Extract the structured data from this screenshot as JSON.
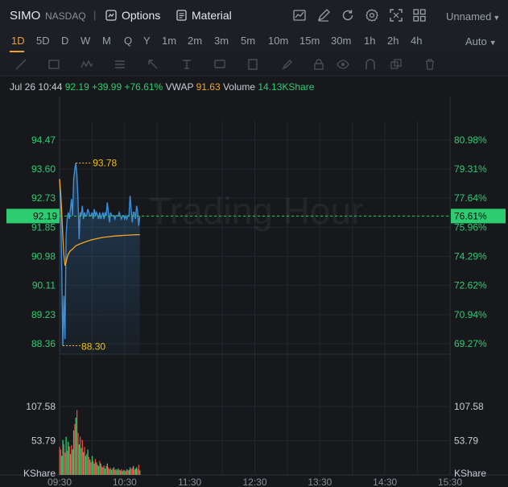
{
  "header": {
    "symbol": "SIMO",
    "exchange": "NASDAQ",
    "options_label": "Options",
    "material_label": "Material",
    "layout_name": "Unnamed",
    "icons": [
      "options-icon",
      "material-icon",
      "chart-type-icon",
      "draw-icon",
      "refresh-icon",
      "settings-icon",
      "fullscreen-icon",
      "layout-icon"
    ]
  },
  "periods": {
    "items": [
      "1D",
      "5D",
      "D",
      "W",
      "M",
      "Q",
      "Y",
      "1m",
      "2m",
      "3m",
      "5m",
      "10m",
      "15m",
      "30m",
      "1h",
      "2h",
      "4h"
    ],
    "active": "1D",
    "mode": "Auto"
  },
  "drawing_tools": [
    "line-tool-icon",
    "rectangle-tool-icon",
    "wave-tool-icon",
    "fib-tool-icon",
    "arrow-tool-icon",
    "text-tool-icon",
    "label-tool-icon",
    "ruler-tool-icon",
    "pen-tool-icon",
    "lock-icon",
    "eye-icon",
    "magnet-icon",
    "copy-icon",
    "trash-icon"
  ],
  "quote": {
    "datetime": "Jul 26 10:44",
    "price": "92.19",
    "change": "+39.99",
    "change_pct": "+76.61%",
    "vwap_label": "VWAP",
    "vwap_value": "91.63",
    "volume_label": "Volume",
    "volume_value": "14.13KShare"
  },
  "chart_data": {
    "type": "line",
    "watermark": "Trading Hour",
    "price_ticks_left": [
      "94.47",
      "93.60",
      "92.73",
      "91.85",
      "90.98",
      "90.11",
      "89.23",
      "88.36"
    ],
    "pct_ticks_right": [
      "80.98%",
      "79.31%",
      "77.64%",
      "75.96%",
      "74.29%",
      "72.62%",
      "70.94%",
      "69.27%"
    ],
    "current_price_tag": "92.19",
    "current_pct_tag": "76.61%",
    "high_label": "93.78",
    "low_label": "88.30",
    "time_labels": [
      "09:30",
      "10:30",
      "11:30",
      "12:30",
      "13:30",
      "14:30",
      "15:30"
    ],
    "volume_ticks": [
      "107.58",
      "53.79"
    ],
    "volume_unit": "KShare",
    "colors": {
      "price": "#3d8fd9",
      "vwap": "#f5a623",
      "up": "#2ecc71",
      "down": "#e74c3c",
      "tag": "#2ecc71",
      "annot": "#f5c000"
    },
    "price_series": [
      [
        "09:30",
        93.3
      ],
      [
        "09:31",
        92.6
      ],
      [
        "09:32",
        90.6
      ],
      [
        "09:33",
        88.3
      ],
      [
        "09:34",
        89.8
      ],
      [
        "09:35",
        88.5
      ],
      [
        "09:36",
        91.6
      ],
      [
        "09:37",
        92.1
      ],
      [
        "09:38",
        92.3
      ],
      [
        "09:39",
        92.1
      ],
      [
        "09:40",
        92.4
      ],
      [
        "09:41",
        92.7
      ],
      [
        "09:42",
        92.2
      ],
      [
        "09:43",
        93.3
      ],
      [
        "09:44",
        93.6
      ],
      [
        "09:45",
        93.78
      ],
      [
        "09:46",
        93.4
      ],
      [
        "09:47",
        92.7
      ],
      [
        "09:48",
        91.5
      ],
      [
        "09:49",
        92.3
      ],
      [
        "09:50",
        92.2
      ],
      [
        "09:51",
        92.5
      ],
      [
        "09:52",
        92.1
      ],
      [
        "09:53",
        92.3
      ],
      [
        "09:54",
        92.2
      ],
      [
        "09:55",
        92.2
      ],
      [
        "09:56",
        92.4
      ],
      [
        "09:57",
        92.3
      ],
      [
        "09:58",
        92.2
      ],
      [
        "09:59",
        92.2
      ],
      [
        "10:00",
        92.3
      ],
      [
        "10:01",
        92.1
      ],
      [
        "10:02",
        92.4
      ],
      [
        "10:03",
        92.2
      ],
      [
        "10:04",
        92.3
      ],
      [
        "10:05",
        92.2
      ],
      [
        "10:06",
        92.1
      ],
      [
        "10:07",
        92.3
      ],
      [
        "10:08",
        92.1
      ],
      [
        "10:09",
        92.2
      ],
      [
        "10:10",
        92.3
      ],
      [
        "10:11",
        92.1
      ],
      [
        "10:12",
        92.3
      ],
      [
        "10:13",
        92.2
      ],
      [
        "10:14",
        92.6
      ],
      [
        "10:15",
        92.3
      ],
      [
        "10:16",
        92.0
      ],
      [
        "10:17",
        92.3
      ],
      [
        "10:18",
        92.2
      ],
      [
        "10:19",
        92.2
      ],
      [
        "10:20",
        92.2
      ],
      [
        "10:21",
        92.1
      ],
      [
        "10:22",
        92.2
      ],
      [
        "10:23",
        92.2
      ],
      [
        "10:24",
        92.2
      ],
      [
        "10:25",
        92.3
      ],
      [
        "10:26",
        92.2
      ],
      [
        "10:27",
        92.1
      ],
      [
        "10:28",
        92.2
      ],
      [
        "10:29",
        92.2
      ],
      [
        "10:30",
        92.1
      ],
      [
        "10:31",
        92.2
      ],
      [
        "10:32",
        92.1
      ],
      [
        "10:33",
        92.2
      ],
      [
        "10:34",
        92.2
      ],
      [
        "10:35",
        92.8
      ],
      [
        "10:36",
        92.4
      ],
      [
        "10:37",
        92.0
      ],
      [
        "10:38",
        92.3
      ],
      [
        "10:39",
        92.3
      ],
      [
        "10:40",
        92.1
      ],
      [
        "10:41",
        92.5
      ],
      [
        "10:42",
        92.3
      ],
      [
        "10:43",
        91.9
      ],
      [
        "10:44",
        92.19
      ]
    ],
    "vwap_series": [
      [
        "09:30",
        93.3
      ],
      [
        "09:31",
        92.9
      ],
      [
        "09:32",
        92.3
      ],
      [
        "09:33",
        91.6
      ],
      [
        "09:34",
        91.0
      ],
      [
        "09:35",
        90.7
      ],
      [
        "09:36",
        90.8
      ],
      [
        "09:37",
        90.95
      ],
      [
        "09:38",
        91.05
      ],
      [
        "09:39",
        91.1
      ],
      [
        "09:40",
        91.15
      ],
      [
        "09:42",
        91.2
      ],
      [
        "09:45",
        91.3
      ],
      [
        "09:50",
        91.37
      ],
      [
        "09:55",
        91.43
      ],
      [
        "10:00",
        91.48
      ],
      [
        "10:05",
        91.52
      ],
      [
        "10:10",
        91.55
      ],
      [
        "10:15",
        91.57
      ],
      [
        "10:20",
        91.59
      ],
      [
        "10:25",
        91.6
      ],
      [
        "10:30",
        91.61
      ],
      [
        "10:35",
        91.62
      ],
      [
        "10:40",
        91.63
      ],
      [
        "10:44",
        91.63
      ]
    ],
    "volume_series": [
      [
        "09:30",
        44,
        0
      ],
      [
        "09:31",
        40,
        0
      ],
      [
        "09:32",
        30,
        1
      ],
      [
        "09:33",
        55,
        1
      ],
      [
        "09:34",
        48,
        0
      ],
      [
        "09:35",
        35,
        0
      ],
      [
        "09:36",
        60,
        1
      ],
      [
        "09:37",
        38,
        0
      ],
      [
        "09:38",
        52,
        1
      ],
      [
        "09:39",
        45,
        0
      ],
      [
        "09:40",
        33,
        1
      ],
      [
        "09:41",
        47,
        0
      ],
      [
        "09:42",
        40,
        1
      ],
      [
        "09:43",
        70,
        1
      ],
      [
        "09:44",
        80,
        0
      ],
      [
        "09:45",
        90,
        1
      ],
      [
        "09:46",
        102,
        0
      ],
      [
        "09:47",
        66,
        0
      ],
      [
        "09:48",
        48,
        1
      ],
      [
        "09:49",
        60,
        0
      ],
      [
        "09:50",
        42,
        1
      ],
      [
        "09:51",
        55,
        0
      ],
      [
        "09:52",
        36,
        1
      ],
      [
        "09:53",
        44,
        0
      ],
      [
        "09:54",
        30,
        1
      ],
      [
        "09:55",
        33,
        0
      ],
      [
        "09:56",
        40,
        1
      ],
      [
        "09:57",
        28,
        0
      ],
      [
        "09:58",
        24,
        1
      ],
      [
        "09:59",
        20,
        0
      ],
      [
        "10:00",
        30,
        1
      ],
      [
        "10:01",
        22,
        0
      ],
      [
        "10:02",
        18,
        1
      ],
      [
        "10:03",
        25,
        0
      ],
      [
        "10:04",
        20,
        1
      ],
      [
        "10:05",
        16,
        0
      ],
      [
        "10:06",
        14,
        1
      ],
      [
        "10:07",
        22,
        0
      ],
      [
        "10:08",
        18,
        1
      ],
      [
        "10:09",
        13,
        0
      ],
      [
        "10:10",
        12,
        1
      ],
      [
        "10:11",
        15,
        0
      ],
      [
        "10:12",
        10,
        1
      ],
      [
        "10:13",
        14,
        0
      ],
      [
        "10:14",
        18,
        1
      ],
      [
        "10:15",
        12,
        0
      ],
      [
        "10:16",
        9,
        1
      ],
      [
        "10:17",
        11,
        0
      ],
      [
        "10:18",
        8,
        1
      ],
      [
        "10:19",
        10,
        0
      ],
      [
        "10:20",
        12,
        1
      ],
      [
        "10:21",
        8,
        0
      ],
      [
        "10:22",
        9,
        1
      ],
      [
        "10:23",
        7,
        0
      ],
      [
        "10:24",
        10,
        1
      ],
      [
        "10:25",
        8,
        0
      ],
      [
        "10:26",
        7,
        1
      ],
      [
        "10:27",
        9,
        0
      ],
      [
        "10:28",
        6,
        1
      ],
      [
        "10:29",
        8,
        0
      ],
      [
        "10:30",
        7,
        1
      ],
      [
        "10:31",
        6,
        0
      ],
      [
        "10:32",
        9,
        1
      ],
      [
        "10:33",
        7,
        0
      ],
      [
        "10:34",
        8,
        1
      ],
      [
        "10:35",
        12,
        1
      ],
      [
        "10:36",
        9,
        0
      ],
      [
        "10:37",
        11,
        0
      ],
      [
        "10:38",
        14,
        1
      ],
      [
        "10:39",
        8,
        0
      ],
      [
        "10:40",
        10,
        1
      ],
      [
        "10:41",
        12,
        1
      ],
      [
        "10:42",
        9,
        0
      ],
      [
        "10:43",
        16,
        0
      ],
      [
        "10:44",
        7,
        1
      ]
    ]
  }
}
